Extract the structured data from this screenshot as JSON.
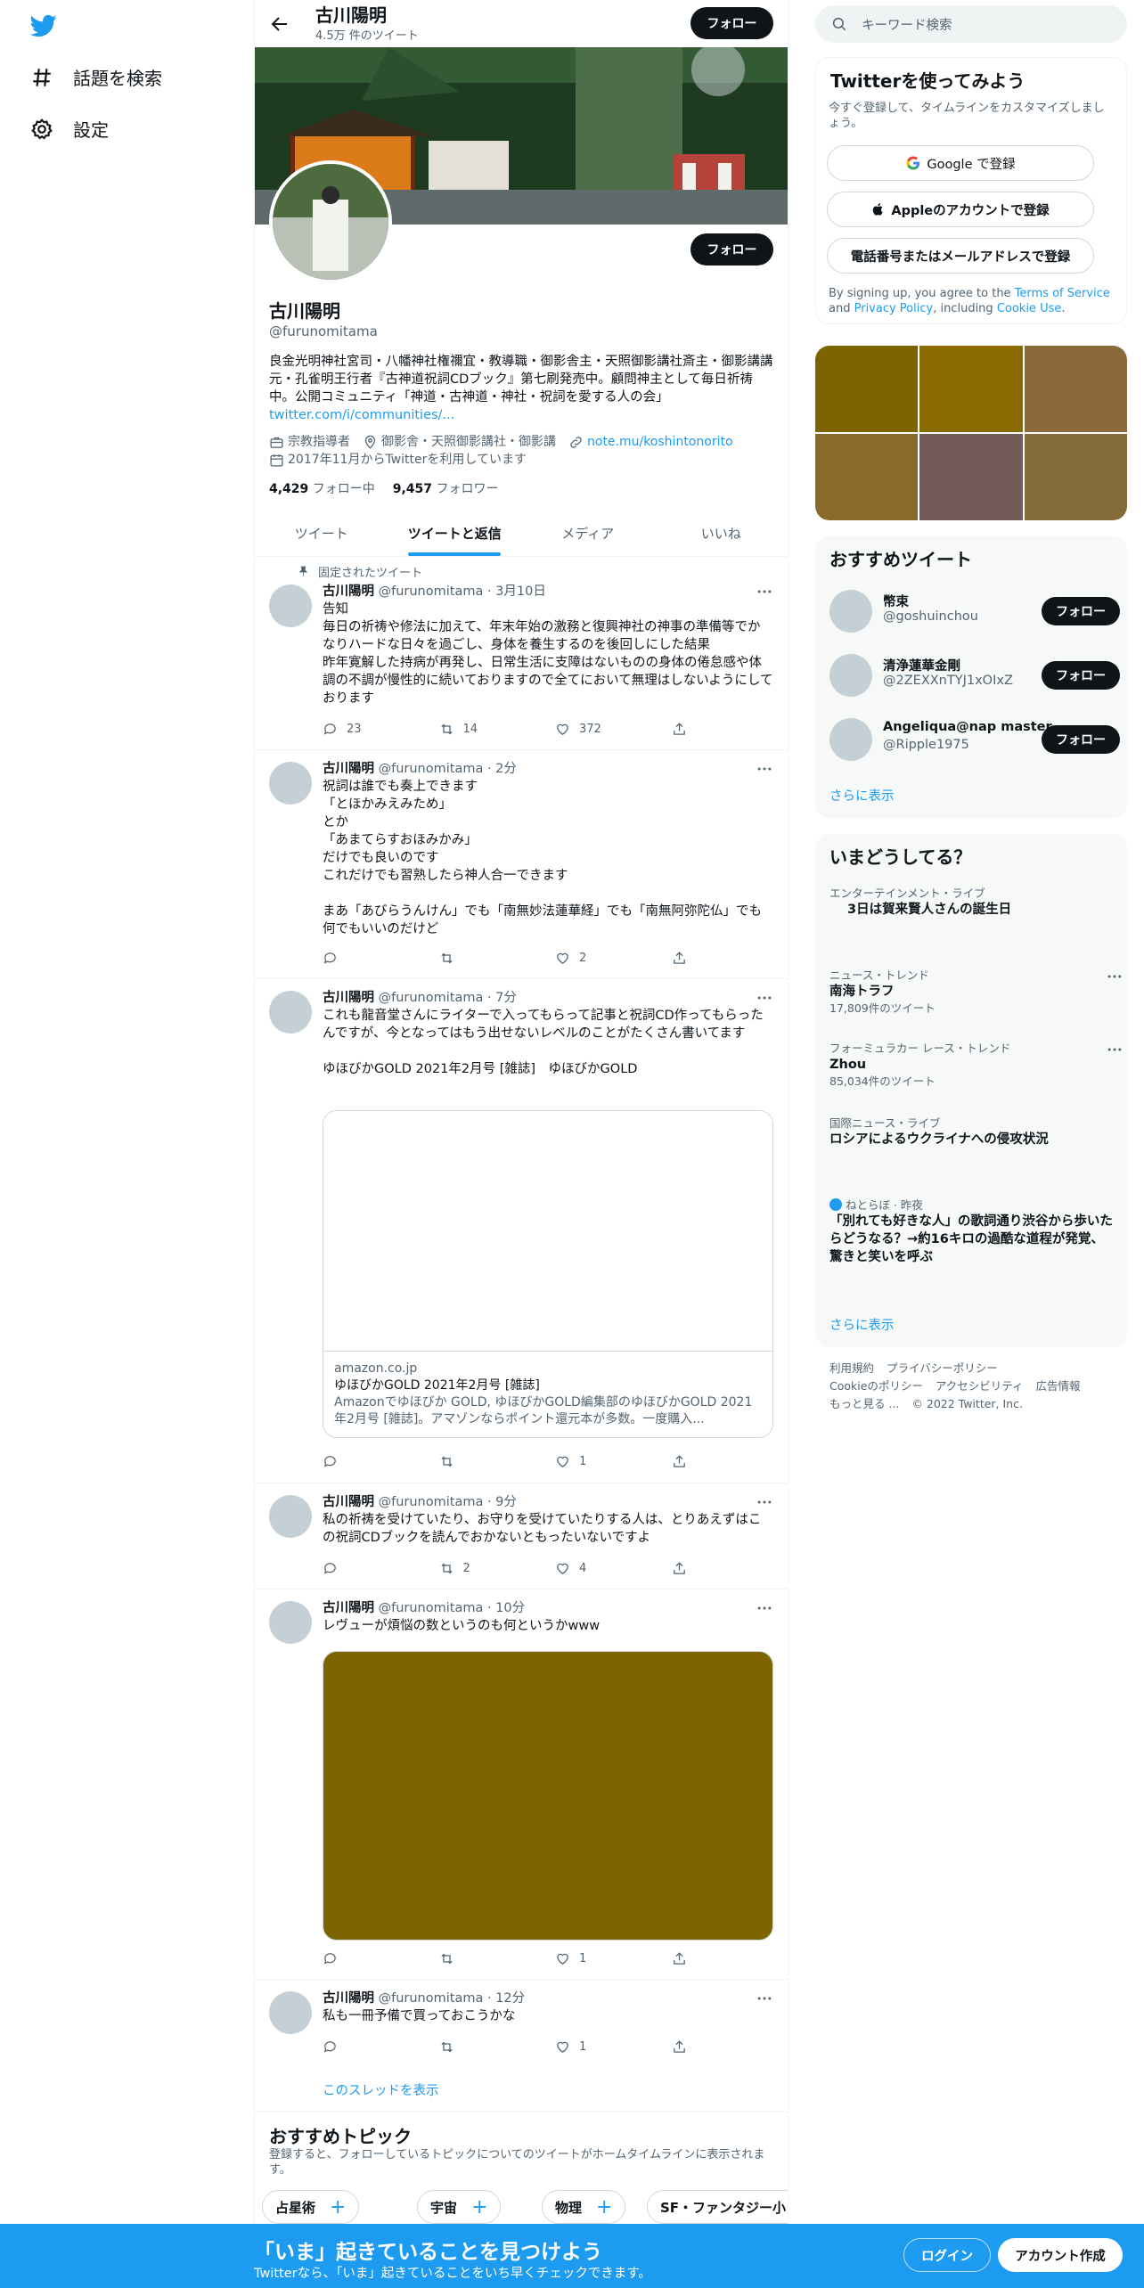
{
  "nav": {
    "explore_label": "話題を検索",
    "settings_label": "設定"
  },
  "header": {
    "name": "古川陽明",
    "tweet_count": "4.5万 件のツイート",
    "follow_label": "フォロー"
  },
  "profile": {
    "name": "古川陽明",
    "handle": "@furunomitama",
    "follow_label": "フォロー",
    "bio": "良金光明神社宮司・八幡神社権禰宜・教導職・御影舎主・天照御影講社斎主・御影講講元・孔雀明王行者『古神道祝詞CDブック』第七刷発売中。顧問神主として毎日祈祷中。公開コミュニティ「神道・古神道・神社・祝詞を愛する人の会」",
    "bio_link": "twitter.com/i/communities/...",
    "category": "宗教指導者",
    "location": "御影舎・天照御影講社・御影講",
    "website": "note.mu/koshintonorito",
    "joined": "2017年11月からTwitterを利用しています",
    "following_count": "4,429",
    "following_label": "フォロー中",
    "followers_count": "9,457",
    "followers_label": "フォロワー"
  },
  "tabs": [
    {
      "label": "ツイート"
    },
    {
      "label": "ツイートと返信"
    },
    {
      "label": "メディア"
    },
    {
      "label": "いいね"
    }
  ],
  "tweets": [
    {
      "pinned_label": "固定されたツイート",
      "name": "古川陽明",
      "meta": "@furunomitama · 3月10日",
      "text": "告知\n毎日の祈祷や修法に加えて、年末年始の激務と復興神社の神事の準備等でかなりハードな日々を過ごし、身体を養生するのを後回しにした結果\n昨年寛解した持病が再発し、日常生活に支障はないものの身体の倦怠感や体調の不調が慢性的に続いておりますので全てにおいて無理はしないようにしております",
      "reply": "23",
      "retweet": "14",
      "like": "372"
    },
    {
      "name": "古川陽明",
      "meta": "@furunomitama · 2分",
      "text": "祝詞は誰でも奏上できます\n「とほかみえみため」\nとか\n「あまてらすおほみかみ」\nだけでも良いのです\nこれだけでも習熟したら神人合一できます\n\nまあ「あびらうんけん」でも「南無妙法蓮華経」でも「南無阿弥陀仏」でも何でもいいのだけど",
      "reply": "",
      "retweet": "",
      "like": "2"
    },
    {
      "name": "古川陽明",
      "meta": "@furunomitama · 7分",
      "text": "これも龍音堂さんにライターで入ってもらって記事と祝詞CD作ってもらったんですが、今となってはもう出せないレベルのことがたくさん書いてます\n\nゆほびかGOLD 2021年2月号 [雑誌]　ゆほびかGOLD",
      "card_domain": "amazon.co.jp",
      "card_title": "ゆほびかGOLD 2021年2月号 [雑誌]",
      "card_desc": "Amazonでゆほびか GOLD, ゆほびかGOLD編集部のゆほびかGOLD 2021年2月号 [雑誌]。アマゾンならポイント還元本が多数。一度購入...",
      "reply": "",
      "retweet": "",
      "like": "1"
    },
    {
      "name": "古川陽明",
      "meta": "@furunomitama · 9分",
      "text": "私の祈祷を受けていたり、お守りを受けていたりする人は、とりあえずはこの祝詞CDブックを読んでおかないともったいないですよ",
      "reply": "",
      "retweet": "2",
      "like": "4"
    },
    {
      "name": "古川陽明",
      "meta": "@furunomitama · 10分",
      "text": "レヴューが煩悩の数というのも何というかwww",
      "reply": "",
      "retweet": "",
      "like": "1"
    },
    {
      "name": "古川陽明",
      "meta": "@furunomitama · 12分",
      "text": "私も一冊予備で買っておこうかな",
      "reply": "",
      "retweet": "",
      "like": "1"
    }
  ],
  "show_thread_label": "このスレッドを表示",
  "topics": {
    "title": "おすすめトピック",
    "desc": "登録すると、フォローしているトピックについてのツイートがホームタイムラインに表示されます。",
    "chips": [
      "占星術",
      "宇宙",
      "物理",
      "SF・ファンタジー小"
    ]
  },
  "search": {
    "placeholder": "キーワード検索"
  },
  "signup": {
    "title": "Twitterを使ってみよう",
    "desc": "今すぐ登録して、タイムラインをカスタマイズしましょう。",
    "google": "Google で登録",
    "apple": "Appleのアカウントで登録",
    "phone": "電話番号またはメールアドレスで登録",
    "legal_pre": "By signing up, you agree to the ",
    "tos": "Terms of Service",
    "and": " and ",
    "privacy": "Privacy Policy",
    "including": ", including ",
    "cookie": "Cookie Use",
    "dot": "."
  },
  "media_grid_colors": [
    "#7d6400",
    "#8a6b00",
    "#8a6a3a",
    "#8a6a2a",
    "#735b5b",
    "#856a3a"
  ],
  "recs": {
    "title": "おすすめツイート",
    "users": [
      {
        "name": "幣束",
        "handle": "@goshuinchou",
        "follow": "フォロー"
      },
      {
        "name": "清浄蓮華金剛",
        "handle": "@2ZEXXnTYJ1xOIxZ",
        "follow": "フォロー"
      },
      {
        "name": "Angeliqua@nap master",
        "handle": "@Ripple1975",
        "follow": "フォロー"
      }
    ],
    "more": "さらに表示"
  },
  "trends": {
    "title": "いまどうしてる？",
    "items": [
      {
        "category": "エンターテインメント・ライブ",
        "title": "3日は賀来賢人さんの誕生日",
        "count": ""
      },
      {
        "category": "ニュース・トレンド",
        "title": "南海トラフ",
        "count": "17,809件のツイート"
      },
      {
        "category": "フォーミュラカー レース・トレンド",
        "title": "Zhou",
        "count": "85,034件のツイート"
      },
      {
        "category": "国際ニュース・ライブ",
        "title": "ロシアによるウクライナへの侵攻状況",
        "count": ""
      },
      {
        "category": "ねとらぼ · 昨夜",
        "title": "「別れても好きな人」の歌詞通り渋谷から歩いたらどうなる？→約16キロの過酷な道程が発覚、驚きと笑いを呼ぶ",
        "count": ""
      }
    ],
    "more": "さらに表示"
  },
  "footer": {
    "terms": "利用規約",
    "privacy": "プライバシーポリシー",
    "cookie": "Cookieのポリシー",
    "access": "アクセシビリティ",
    "ads": "広告情報",
    "more": "もっと見る ...",
    "copy": "© 2022 Twitter, Inc."
  },
  "bottom": {
    "headline": "「いま」起きていることを見つけよう",
    "sub": "Twitterなら、「いま」起きていることをいち早くチェックできます。",
    "login": "ログイン",
    "signup": "アカウント作成"
  },
  "colors": {
    "accent": "#1d9bf0",
    "banner": "#1d9bf0"
  }
}
